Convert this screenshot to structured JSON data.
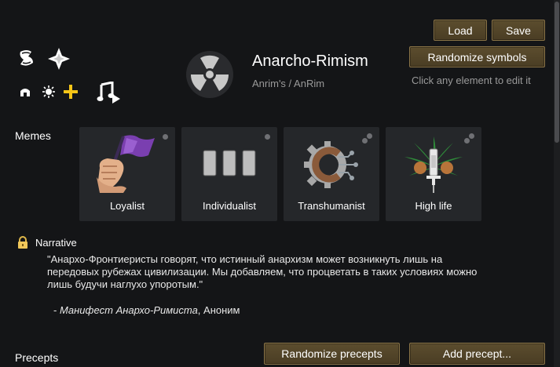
{
  "header": {
    "title": "Anarcho-Rimism",
    "subtitle": "Anrim's / AnRim",
    "hint": "Click any element to edit it"
  },
  "buttons": {
    "load": "Load",
    "save": "Save",
    "randomize_symbols": "Randomize symbols",
    "randomize_precepts": "Randomize precepts",
    "add_precept": "Add precept..."
  },
  "memes": {
    "section_label": "Memes",
    "items": [
      {
        "label": "Loyalist",
        "icon": "flag-fist-icon"
      },
      {
        "label": "Individualist",
        "icon": "three-bars-icon"
      },
      {
        "label": "Transhumanist",
        "icon": "gear-c-icon"
      },
      {
        "label": "High life",
        "icon": "leaf-syringe-icon"
      }
    ]
  },
  "narrative": {
    "label": "Narrative",
    "text_line1": "\"Анархо-Фронтиеристы говорят, что истинный анархизм может возникнуть лишь на",
    "text_line2": "передовых рубежах цивилизации. Мы добавляем, что процветать в таких условиях можно",
    "text_line3": "лишь будучи наглухо упоротым.\"",
    "attribution_prefix": "- ",
    "attribution_title": "Манифест Анархо-Римиста",
    "attribution_suffix": ", Аноним"
  },
  "precepts": {
    "section_label": "Precepts"
  },
  "colors": {
    "background": "#141517",
    "card": "#25272a",
    "button": "#4a3d24",
    "button_border": "#8a7447",
    "accent_yellow": "#f5c518",
    "flag_purple": "#7a3fb0"
  }
}
